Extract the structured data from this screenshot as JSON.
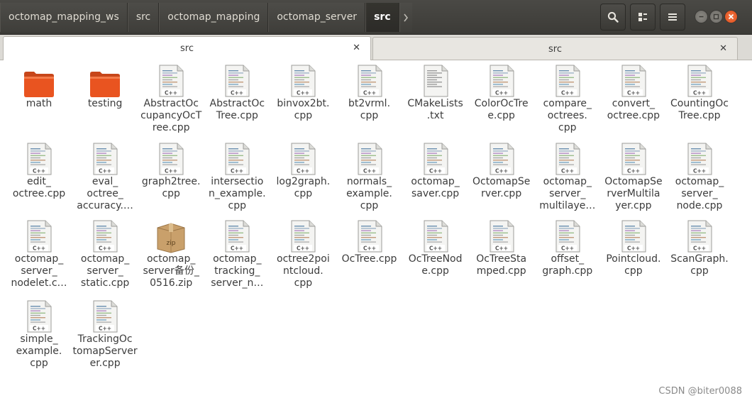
{
  "header": {
    "breadcrumbs": [
      "octomap_mapping_ws",
      "src",
      "octomap_mapping",
      "octomap_server",
      "src"
    ],
    "icons": {
      "more": "chevron-right-icon",
      "search": "search-icon",
      "view": "view-options-icon",
      "menu": "hamburger-menu-icon",
      "minimize": "minimize-icon",
      "maximize": "maximize-icon",
      "close": "close-icon"
    }
  },
  "tabs": [
    {
      "label": "src",
      "active": true
    },
    {
      "label": "src",
      "active": false
    }
  ],
  "files": [
    {
      "name": "math",
      "type": "folder"
    },
    {
      "name": "testing",
      "type": "folder"
    },
    {
      "name": "AbstractOc\ncupancyOcT\nree.cpp",
      "type": "cpp"
    },
    {
      "name": "AbstractOc\nTree.cpp",
      "type": "cpp"
    },
    {
      "name": "binvox2bt.\ncpp",
      "type": "cpp"
    },
    {
      "name": "bt2vrml.\ncpp",
      "type": "cpp"
    },
    {
      "name": "CMakeLists\n.txt",
      "type": "txt"
    },
    {
      "name": "ColorOcTre\ne.cpp",
      "type": "cpp"
    },
    {
      "name": "compare_\noctrees.\ncpp",
      "type": "cpp"
    },
    {
      "name": "convert_\noctree.cpp",
      "type": "cpp"
    },
    {
      "name": "CountingOc\nTree.cpp",
      "type": "cpp"
    },
    {
      "name": "edit_\noctree.cpp",
      "type": "cpp"
    },
    {
      "name": "eval_\noctree_\naccuracy.…",
      "type": "cpp"
    },
    {
      "name": "graph2tree.\ncpp",
      "type": "cpp"
    },
    {
      "name": "intersectio\nn_example.\ncpp",
      "type": "cpp"
    },
    {
      "name": "log2graph.\ncpp",
      "type": "cpp"
    },
    {
      "name": "normals_\nexample.\ncpp",
      "type": "cpp"
    },
    {
      "name": "octomap_\nsaver.cpp",
      "type": "cpp"
    },
    {
      "name": "OctomapSe\nrver.cpp",
      "type": "cpp"
    },
    {
      "name": "octomap_\nserver_\nmultilaye…",
      "type": "cpp"
    },
    {
      "name": "OctomapSe\nrverMultila\nyer.cpp",
      "type": "cpp"
    },
    {
      "name": "octomap_\nserver_\nnode.cpp",
      "type": "cpp"
    },
    {
      "name": "octomap_\nserver_\nnodelet.c…",
      "type": "cpp"
    },
    {
      "name": "octomap_\nserver_\nstatic.cpp",
      "type": "cpp"
    },
    {
      "name": "octomap_\nserver备份_\n0516.zip",
      "type": "zip",
      "badge": "zip"
    },
    {
      "name": "octomap_\ntracking_\nserver_n…",
      "type": "cpp"
    },
    {
      "name": "octree2poi\nntcloud.\ncpp",
      "type": "cpp"
    },
    {
      "name": "OcTree.cpp",
      "type": "cpp"
    },
    {
      "name": "OcTreeNod\ne.cpp",
      "type": "cpp"
    },
    {
      "name": "OcTreeSta\nmped.cpp",
      "type": "cpp"
    },
    {
      "name": "offset_\ngraph.cpp",
      "type": "cpp"
    },
    {
      "name": "Pointcloud.\ncpp",
      "type": "cpp"
    },
    {
      "name": "ScanGraph.\ncpp",
      "type": "cpp"
    },
    {
      "name": "simple_\nexample.\ncpp",
      "type": "cpp"
    },
    {
      "name": "TrackingOc\ntomapServer\ner.cpp",
      "type": "cpp"
    }
  ],
  "cpp_badge": "C++",
  "watermark": "CSDN @biter0088",
  "colors": {
    "header_bg": "#3c3b37",
    "folder_orange": "#e95420",
    "close_button": "#df4b16"
  }
}
